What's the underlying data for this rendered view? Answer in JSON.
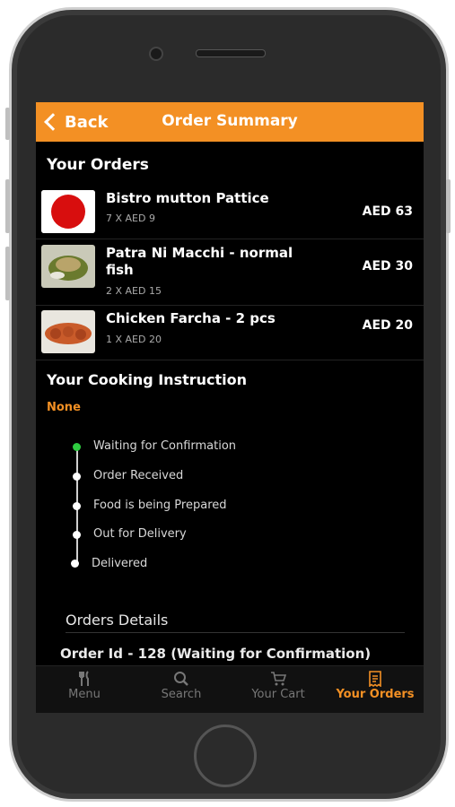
{
  "header": {
    "back_label": "Back",
    "title": "Order Summary"
  },
  "orders": {
    "heading": "Your Orders",
    "items": [
      {
        "name": "Bistro mutton Pattice",
        "qty": "7 X AED 9",
        "price": "AED 63"
      },
      {
        "name": "Patra Ni Macchi - normal fish",
        "qty": "2 X AED 15",
        "price": "AED 30"
      },
      {
        "name": "Chicken Farcha - 2 pcs",
        "qty": "1 X AED 20",
        "price": "AED 20"
      }
    ]
  },
  "cooking": {
    "heading": "Your Cooking Instruction",
    "value": "None"
  },
  "status_steps": [
    "Waiting for Confirmation",
    "Order Received",
    "Food is being Prepared",
    "Out for Delivery",
    "Delivered"
  ],
  "details": {
    "heading": "Orders Details",
    "order_line": "Order Id - 128 (Waiting for Confirmation)"
  },
  "tabs": [
    {
      "label": "Menu",
      "icon": "utensils-icon"
    },
    {
      "label": "Search",
      "icon": "search-icon"
    },
    {
      "label": "Your Cart",
      "icon": "cart-icon"
    },
    {
      "label": "Your Orders",
      "icon": "receipt-icon",
      "active": true
    }
  ],
  "colors": {
    "accent": "#f39024",
    "active_step": "#2ecc40"
  }
}
